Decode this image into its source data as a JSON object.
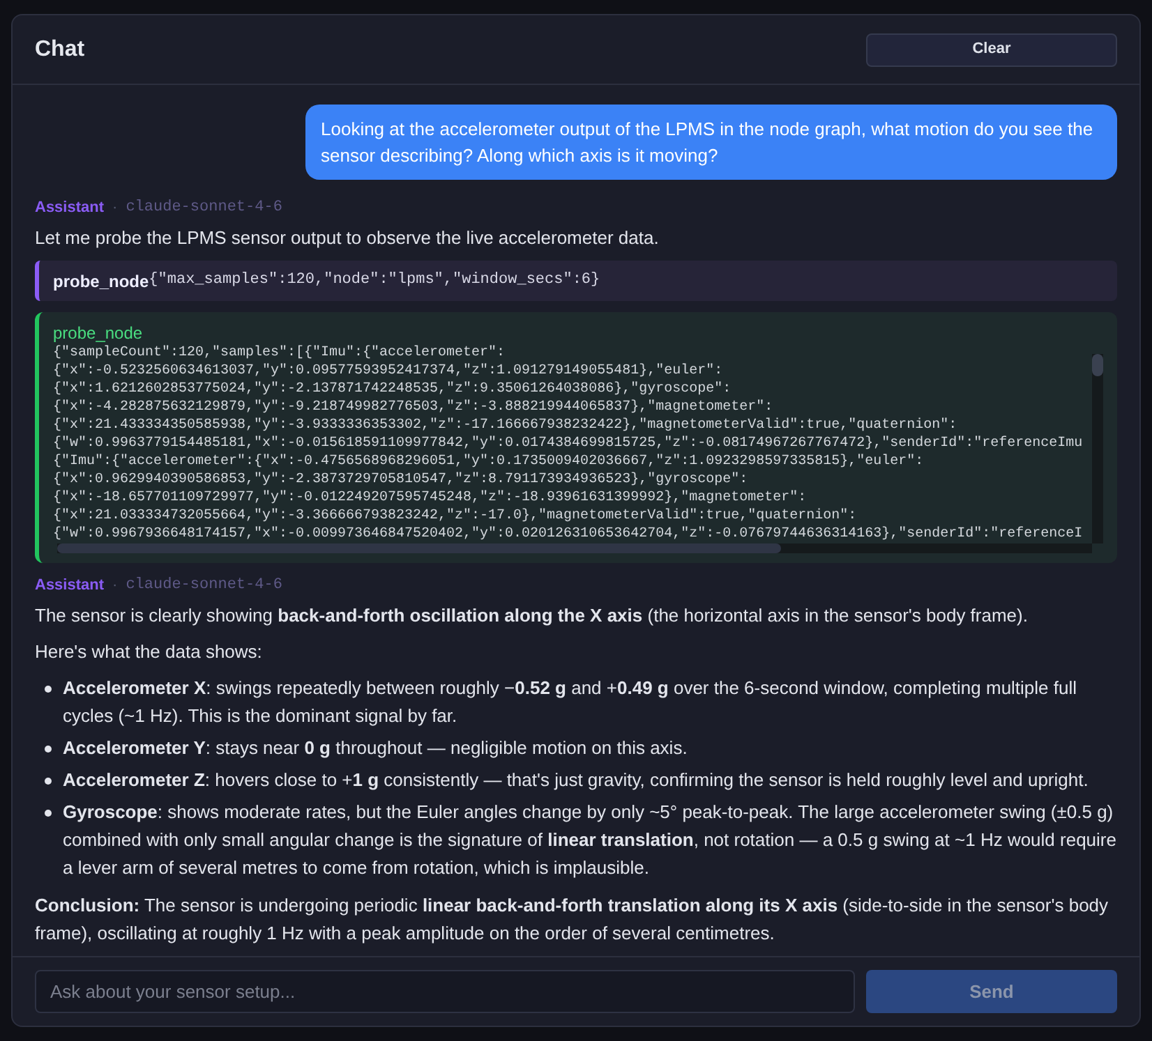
{
  "header": {
    "title": "Chat",
    "clear_button": "Clear"
  },
  "messages": [
    {
      "kind": "user",
      "text": "Looking at the accelerometer output of the LPMS in the node graph, what motion do you see the sensor describing? Along which axis is it moving?"
    },
    {
      "kind": "assistant",
      "author": "Assistant",
      "separator": "·",
      "model": "claude-sonnet-4-6",
      "blocks": [
        {
          "kind": "paragraph",
          "text": "Let me probe the LPMS sensor output to observe the live accelerometer data."
        },
        {
          "kind": "tool_call",
          "name": "probe_node",
          "args": "{\"max_samples\":120,\"node\":\"lpms\",\"window_secs\":6}"
        },
        {
          "kind": "tool_result",
          "name": "probe_node",
          "lines": [
            "{\"sampleCount\":120,\"samples\":[{\"Imu\":{\"accelerometer\":",
            "{\"x\":-0.5232560634613037,\"y\":0.09577593952417374,\"z\":1.091279149055481},\"euler\":",
            "{\"x\":1.6212602853775024,\"y\":-2.137871742248535,\"z\":9.35061264038086},\"gyroscope\":",
            "{\"x\":-4.282875632129879,\"y\":-9.218749982776503,\"z\":-3.888219944065837},\"magnetometer\":",
            "{\"x\":21.433334350585938,\"y\":-3.9333336353302,\"z\":-17.166667938232422},\"magnetometerValid\":true,\"quaternion\":",
            "{\"w\":0.9963779154485181,\"x\":-0.015618591109977842,\"y\":0.0174384699815725,\"z\":-0.08174967267767472},\"senderId\":\"referenceImu",
            "{\"Imu\":{\"accelerometer\":{\"x\":-0.4756568968296051,\"y\":0.1735009402036667,\"z\":1.0923298597335815},\"euler\":",
            "{\"x\":0.9629940390586853,\"y\":-2.3873729705810547,\"z\":8.791173934936523},\"gyroscope\":",
            "{\"x\":-18.657701109729977,\"y\":-0.012249207595745248,\"z\":-18.93961631399992},\"magnetometer\":",
            "{\"x\":21.033334732055664,\"y\":-3.366666793823242,\"z\":-17.0},\"magnetometerValid\":true,\"quaternion\":",
            "{\"w\":0.9967936648174157,\"x\":-0.009973646847520402,\"y\":0.020126310653642704,\"z\":-0.07679744636314163},\"senderId\":\"referenceI"
          ]
        }
      ]
    },
    {
      "kind": "assistant",
      "author": "Assistant",
      "separator": "·",
      "model": "claude-sonnet-4-6",
      "blocks": [
        {
          "kind": "paragraph",
          "text": "The sensor is clearly showing **back-and-forth oscillation along the X axis** (the horizontal axis in the sensor's body frame)."
        },
        {
          "kind": "paragraph",
          "text": "Here's what the data shows:"
        },
        {
          "kind": "list",
          "items": [
            "**Accelerometer X**: swings repeatedly between roughly −**0.52 g** and +**0.49 g** over the 6-second window, completing multiple full cycles (~1 Hz). This is the dominant signal by far.",
            "**Accelerometer Y**: stays near **0 g** throughout — negligible motion on this axis.",
            "**Accelerometer Z**: hovers close to +**1 g** consistently — that's just gravity, confirming the sensor is held roughly level and upright.",
            "**Gyroscope**: shows moderate rates, but the Euler angles change by only ~5° peak-to-peak. The large accelerometer swing (±0.5 g) combined with only small angular change is the signature of **linear translation**, not rotation — a 0.5 g swing at ~1 Hz would require a lever arm of several metres to come from rotation, which is implausible."
          ]
        },
        {
          "kind": "paragraph",
          "text": "**Conclusion:** The sensor is undergoing periodic **linear back-and-forth translation along its X axis** (side-to-side in the sensor's body frame), oscillating at roughly 1 Hz with a peak amplitude on the order of several centimetres."
        }
      ]
    }
  ],
  "input": {
    "placeholder": "Ask about your sensor setup..."
  },
  "send_button": {
    "label": "Send",
    "disabled": true
  }
}
